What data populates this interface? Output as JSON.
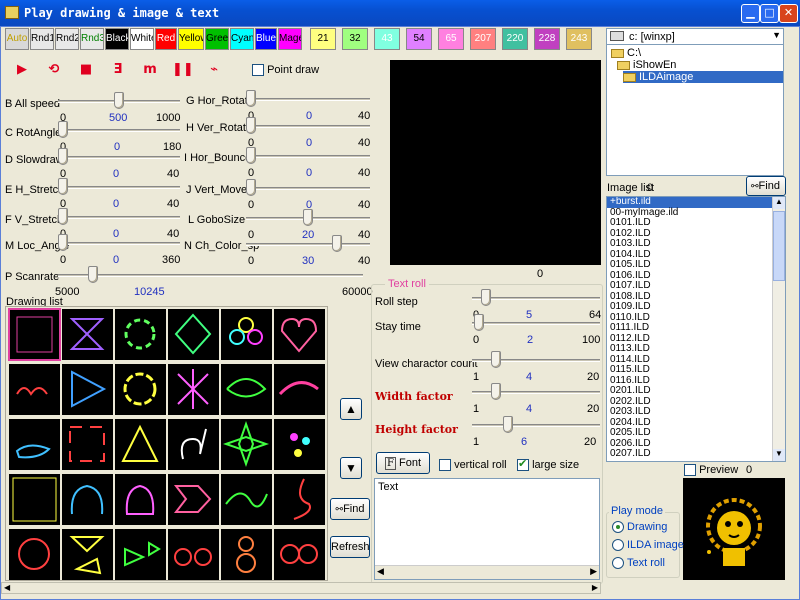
{
  "window": {
    "title": "Play drawing & image & text"
  },
  "color_buttons": [
    {
      "label": "Auto",
      "bg": "#d8d8d8",
      "fg": "#c0a000"
    },
    {
      "label": "Rnd1",
      "bg": "#e8e8e8",
      "fg": "#000000"
    },
    {
      "label": "Rnd2",
      "bg": "#e8e8e8",
      "fg": "#000000"
    },
    {
      "label": "Rnd3",
      "bg": "#e8e8e8",
      "fg": "#008000"
    },
    {
      "label": "Black",
      "bg": "#000000",
      "fg": "#ffffff"
    },
    {
      "label": "White",
      "bg": "#ffffff",
      "fg": "#000000"
    },
    {
      "label": "Red",
      "bg": "#ff0000",
      "fg": "#ffffff"
    },
    {
      "label": "Yellow",
      "bg": "#ffff00",
      "fg": "#000000"
    },
    {
      "label": "Green",
      "bg": "#00c000",
      "fg": "#000000"
    },
    {
      "label": "Cyan",
      "bg": "#00ffff",
      "fg": "#000000"
    },
    {
      "label": "Blue",
      "bg": "#0000ff",
      "fg": "#ffffff"
    },
    {
      "label": "Mage",
      "bg": "#ff00ff",
      "fg": "#000000"
    },
    {
      "label": "21",
      "bg": "#ffff80",
      "fg": "#000000"
    },
    {
      "label": "32",
      "bg": "#a0ff80",
      "fg": "#000000"
    },
    {
      "label": "43",
      "bg": "#80ffe0",
      "fg": "#ffffff"
    },
    {
      "label": "54",
      "bg": "#e080ff",
      "fg": "#000000"
    },
    {
      "label": "65",
      "bg": "#ff80e0",
      "fg": "#ffffff"
    },
    {
      "label": "207",
      "bg": "#ff8080",
      "fg": "#ffffff"
    },
    {
      "label": "220",
      "bg": "#40c0a0",
      "fg": "#ffffff"
    },
    {
      "label": "228",
      "bg": "#c040c0",
      "fg": "#ffffff"
    },
    {
      "label": "243",
      "bg": "#e0c060",
      "fg": "#ffffff"
    }
  ],
  "toolbar": {
    "tools": [
      {
        "name": "play-button",
        "glyph": "▶"
      },
      {
        "name": "loop-button",
        "glyph": "⟲"
      },
      {
        "name": "stop-button",
        "glyph": "■"
      },
      {
        "name": "step-button",
        "glyph": "Ǝ"
      },
      {
        "name": "multi-button",
        "glyph": "m"
      },
      {
        "name": "pause-button",
        "glyph": "❚❚"
      },
      {
        "name": "path-draw-button",
        "glyph": "⌁"
      }
    ],
    "point_draw_label": "Point draw",
    "point_draw_checked": false
  },
  "sliders_left": [
    {
      "label": "B All speed",
      "min": "0",
      "value": "500",
      "max": "1000",
      "pos": 0.5
    },
    {
      "label": "C RotAngle",
      "min": "0",
      "value": "0",
      "max": "180",
      "pos": 0
    },
    {
      "label": "D Slowdraw",
      "min": "0",
      "value": "0",
      "max": "40",
      "pos": 0
    },
    {
      "label": "E H_Stretch",
      "min": "0",
      "value": "0",
      "max": "40",
      "pos": 0
    },
    {
      "label": "F V_Stretch",
      "min": "0",
      "value": "0",
      "max": "40",
      "pos": 0
    },
    {
      "label": "M Loc_Angle",
      "min": "0",
      "value": "0",
      "max": "360",
      "pos": 0
    }
  ],
  "sliders_right": [
    {
      "label": "G Hor_Rotate",
      "min": "0",
      "value": "0",
      "max": "40",
      "pos": 0
    },
    {
      "label": "H Ver_Rotate",
      "min": "0",
      "value": "0",
      "max": "40",
      "pos": 0
    },
    {
      "label": "I Hor_Bounce",
      "min": "0",
      "value": "0",
      "max": "40",
      "pos": 0
    },
    {
      "label": "J Vert_Move",
      "min": "0",
      "value": "0",
      "max": "40",
      "pos": 0
    },
    {
      "label": "L GoboSize",
      "min": "0",
      "value": "20",
      "max": "40",
      "pos": 0.5
    },
    {
      "label": "N Ch_Color_sp",
      "min": "0",
      "value": "30",
      "max": "40",
      "pos": 0.75
    }
  ],
  "scanrate": {
    "label": "P Scanrate",
    "min": "5000",
    "value": "10245",
    "max": "60000",
    "pos": 0.1
  },
  "preview_counter": "0",
  "drawing_list": {
    "label": "Drawing list"
  },
  "side_buttons": {
    "up": "▲",
    "down": "▼",
    "find": "Find",
    "refresh": "Refresh"
  },
  "text_roll": {
    "title": "Text roll",
    "sliders": [
      {
        "label": "Roll step",
        "min": "0",
        "value": "5",
        "max": "64",
        "pos": 0.08,
        "red": false
      },
      {
        "label": "Stay time",
        "min": "0",
        "value": "2",
        "max": "100",
        "pos": 0.02,
        "red": false
      },
      {
        "label": "View charactor count",
        "min": "1",
        "value": "4",
        "max": "20",
        "pos": 0.16,
        "red": false
      },
      {
        "label": "Width factor",
        "min": "1",
        "value": "4",
        "max": "20",
        "pos": 0.16,
        "red": true
      },
      {
        "label": "Height factor",
        "min": "1",
        "value": "6",
        "max": "20",
        "pos": 0.26,
        "red": true
      }
    ],
    "font_button": "Font",
    "vertical_roll": "vertical roll",
    "vertical_roll_checked": false,
    "large_size": "large size",
    "large_size_checked": true,
    "text_value": "Text"
  },
  "drive": {
    "label": "c: [winxp]"
  },
  "folders": [
    {
      "label": "C:\\",
      "indent": 0,
      "open": true,
      "sel": false
    },
    {
      "label": "iShowEn",
      "indent": 1,
      "open": true,
      "sel": false
    },
    {
      "label": "ILDAimage",
      "indent": 2,
      "open": true,
      "sel": true
    }
  ],
  "image_list": {
    "label": "Image list",
    "count": "0",
    "find_label": "Find",
    "items": [
      "+burst.ild",
      "00-myImage.ild",
      "0101.ILD",
      "0102.ILD",
      "0103.ILD",
      "0104.ILD",
      "0105.ILD",
      "0106.ILD",
      "0107.ILD",
      "0108.ILD",
      "0109.ILD",
      "0110.ILD",
      "0111.ILD",
      "0112.ILD",
      "0113.ILD",
      "0114.ILD",
      "0115.ILD",
      "0116.ILD",
      "0201.ILD",
      "0202.ILD",
      "0203.ILD",
      "0204.ILD",
      "0205.ILD",
      "0206.ILD",
      "0207.ILD"
    ]
  },
  "preview": {
    "label": "Preview",
    "count": "0",
    "checked": false
  },
  "play_mode": {
    "title": "Play mode",
    "options": [
      {
        "label": "Drawing",
        "selected": true
      },
      {
        "label": "ILDA image",
        "selected": false
      },
      {
        "label": "Text roll",
        "selected": false
      }
    ]
  }
}
